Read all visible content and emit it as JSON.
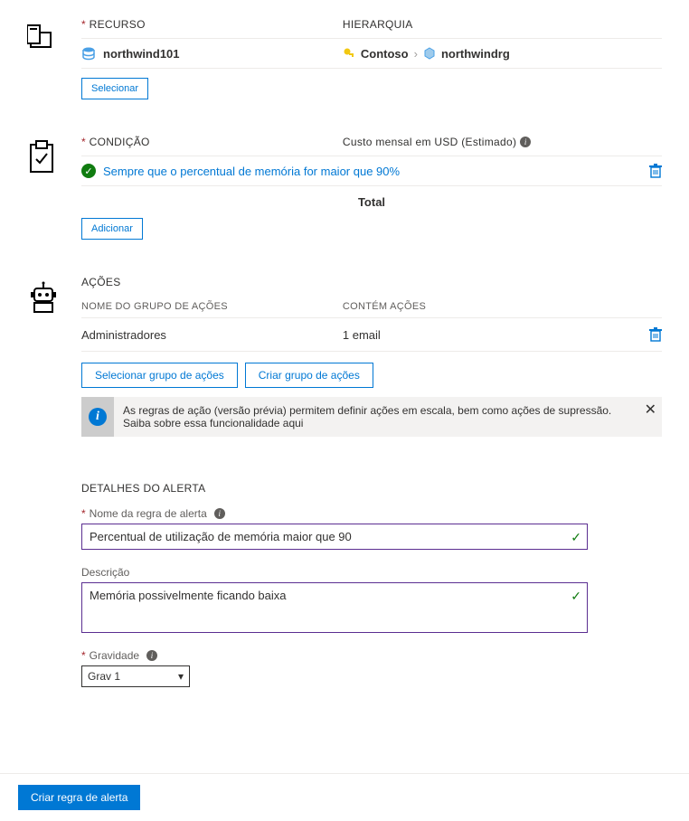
{
  "resource": {
    "label": "RECURSO",
    "hierarchy_label": "HIERARQUIA",
    "name": "northwind101",
    "hierarchy": {
      "org": "Contoso",
      "group": "northwindrg"
    },
    "select_btn": "Selecionar"
  },
  "condition": {
    "label": "CONDIÇÃO",
    "cost_label": "Custo mensal em USD (Estimado)",
    "item": "Sempre que o percentual de memória for maior que 90%",
    "total_label": "Total",
    "add_btn": "Adicionar"
  },
  "actions": {
    "label": "AÇÕES",
    "col_group": "NOME DO GRUPO DE AÇÕES",
    "col_contains": "CONTÉM AÇÕES",
    "row_group": "Administradores",
    "row_contains": "1 email",
    "select_btn": "Selecionar grupo de ações",
    "create_btn": "Criar grupo de ações",
    "banner": "As regras de ação (versão prévia) permitem definir ações em escala, bem como ações de supressão. Saiba sobre essa funcionalidade aqui"
  },
  "details": {
    "heading": "DETALHES DO ALERTA",
    "name_label": "Nome da regra de alerta",
    "name_value": "Percentual de utilização de memória maior que 90",
    "desc_label": "Descrição",
    "desc_value": "Memória possivelmente ficando baixa",
    "sev_label": "Gravidade",
    "sev_value": "Grav 1"
  },
  "footer": {
    "create_btn": "Criar regra de alerta"
  }
}
